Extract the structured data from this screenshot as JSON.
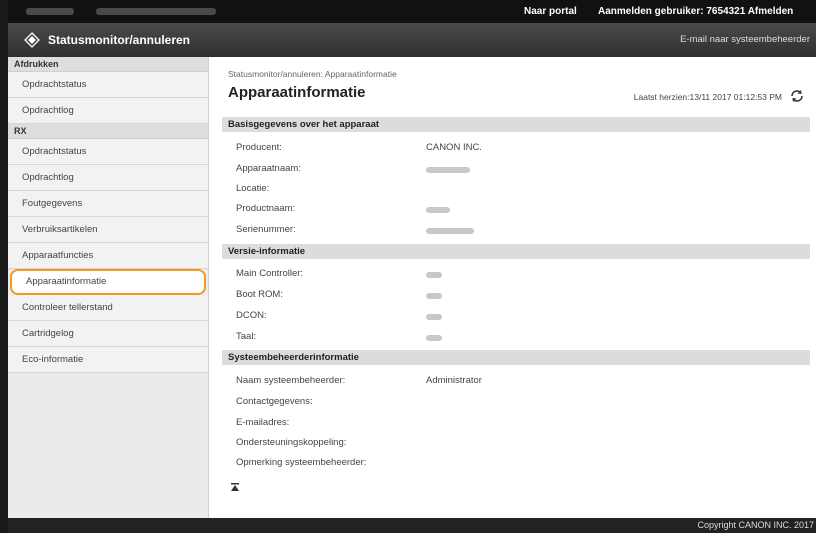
{
  "topbar": {
    "portal_label": "Naar portal",
    "logged_in_label": "Aanmelden gebruiker:  7654321  Afmelden"
  },
  "header": {
    "title": "Statusmonitor/annuleren",
    "email_link": "E-mail naar systeembeheerder"
  },
  "sidebar": {
    "sections": [
      {
        "title": "Afdrukken",
        "items": [
          "Opdrachtstatus",
          "Opdrachtlog"
        ]
      },
      {
        "title": "RX",
        "items": [
          "Opdrachtstatus",
          "Opdrachtlog",
          "Foutgegevens",
          "Verbruiksartikelen",
          "Apparaatfuncties",
          "Apparaatinformatie",
          "Controleer tellerstand",
          "Cartridgelog",
          "Eco-informatie"
        ]
      }
    ],
    "active_item": "Apparaatinformatie"
  },
  "main": {
    "breadcrumb": "Statusmonitor/annuleren: Apparaatinformatie",
    "title": "Apparaatinformatie",
    "last_updated": "Laatst herzien:13/11 2017 01:12:53 PM",
    "sections": [
      {
        "title": "Basisgegevens over het apparaat",
        "rows": [
          {
            "label": "Producent:",
            "value": "CANON INC."
          },
          {
            "label": "Apparaatnaam:",
            "value": ""
          },
          {
            "label": "Locatie:",
            "value": ""
          },
          {
            "label": "Productnaam:",
            "value": ""
          },
          {
            "label": "Serienummer:",
            "value": ""
          }
        ]
      },
      {
        "title": "Versie-informatie",
        "rows": [
          {
            "label": "Main Controller:",
            "value": ""
          },
          {
            "label": "Boot ROM:",
            "value": ""
          },
          {
            "label": "DCON:",
            "value": ""
          },
          {
            "label": "Taal:",
            "value": ""
          }
        ]
      },
      {
        "title": "Systeembeheerderinformatie",
        "rows": [
          {
            "label": "Naam systeembeheerder:",
            "value": "Administrator"
          },
          {
            "label": "Contactgegevens:",
            "value": ""
          },
          {
            "label": "E-mailadres:",
            "value": ""
          },
          {
            "label": "Ondersteuningskoppeling:",
            "value": ""
          },
          {
            "label": "Opmerking systeembeheerder:",
            "value": ""
          }
        ]
      }
    ]
  },
  "footer": {
    "copyright": "Copyright CANON INC. 2017"
  },
  "colors": {
    "highlight": "#f29a1d",
    "header_bg": "#3a3a3a",
    "section_bg": "#dcdcdc"
  },
  "icons": [
    "logo-icon",
    "refresh-icon",
    "back-to-top-icon"
  ]
}
